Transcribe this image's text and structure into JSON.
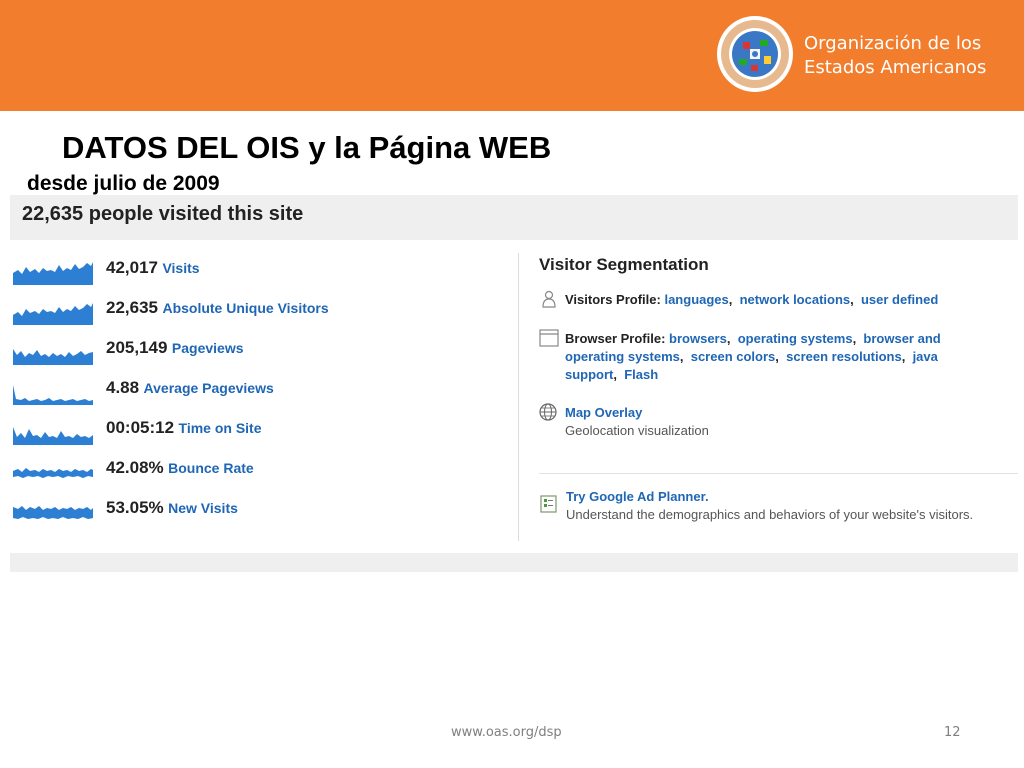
{
  "header": {
    "org_line1": "Organización de los",
    "org_line2": "Estados Americanos",
    "seal_icon": "oas-seal-icon",
    "banner_color": "#f27d2d"
  },
  "slide": {
    "title": "DATOS DEL OIS y la Página WEB",
    "subtitle": "desde julio de 2009"
  },
  "analytics": {
    "headline": "22,635 people visited this site",
    "metrics": [
      {
        "value": "42,017",
        "label": "Visits"
      },
      {
        "value": "22,635",
        "label": "Absolute Unique Visitors"
      },
      {
        "value": "205,149",
        "label": "Pageviews"
      },
      {
        "value": "4.88",
        "label": "Average Pageviews"
      },
      {
        "value": "00:05:12",
        "label": "Time on Site"
      },
      {
        "value": "42.08%",
        "label": "Bounce Rate"
      },
      {
        "value": "53.05%",
        "label": "New Visits"
      }
    ],
    "segmentation": {
      "title": "Visitor Segmentation",
      "visitors_profile": {
        "label": "Visitors Profile:",
        "links": [
          "languages",
          "network locations",
          "user defined"
        ]
      },
      "browser_profile": {
        "label": "Browser Profile:",
        "links": [
          "browsers",
          "operating systems",
          "browser and operating systems",
          "screen colors",
          "screen resolutions",
          "java support",
          "Flash"
        ]
      },
      "map_overlay": {
        "title": "Map Overlay",
        "desc": "Geolocation visualization"
      },
      "ad_planner": {
        "title": "Try Google Ad Planner.",
        "desc": "Understand the demographics and behaviors of your website's visitors."
      }
    },
    "link_color": "#1f66b5"
  },
  "footer": {
    "url": "www.oas.org/dsp",
    "page": "12"
  }
}
